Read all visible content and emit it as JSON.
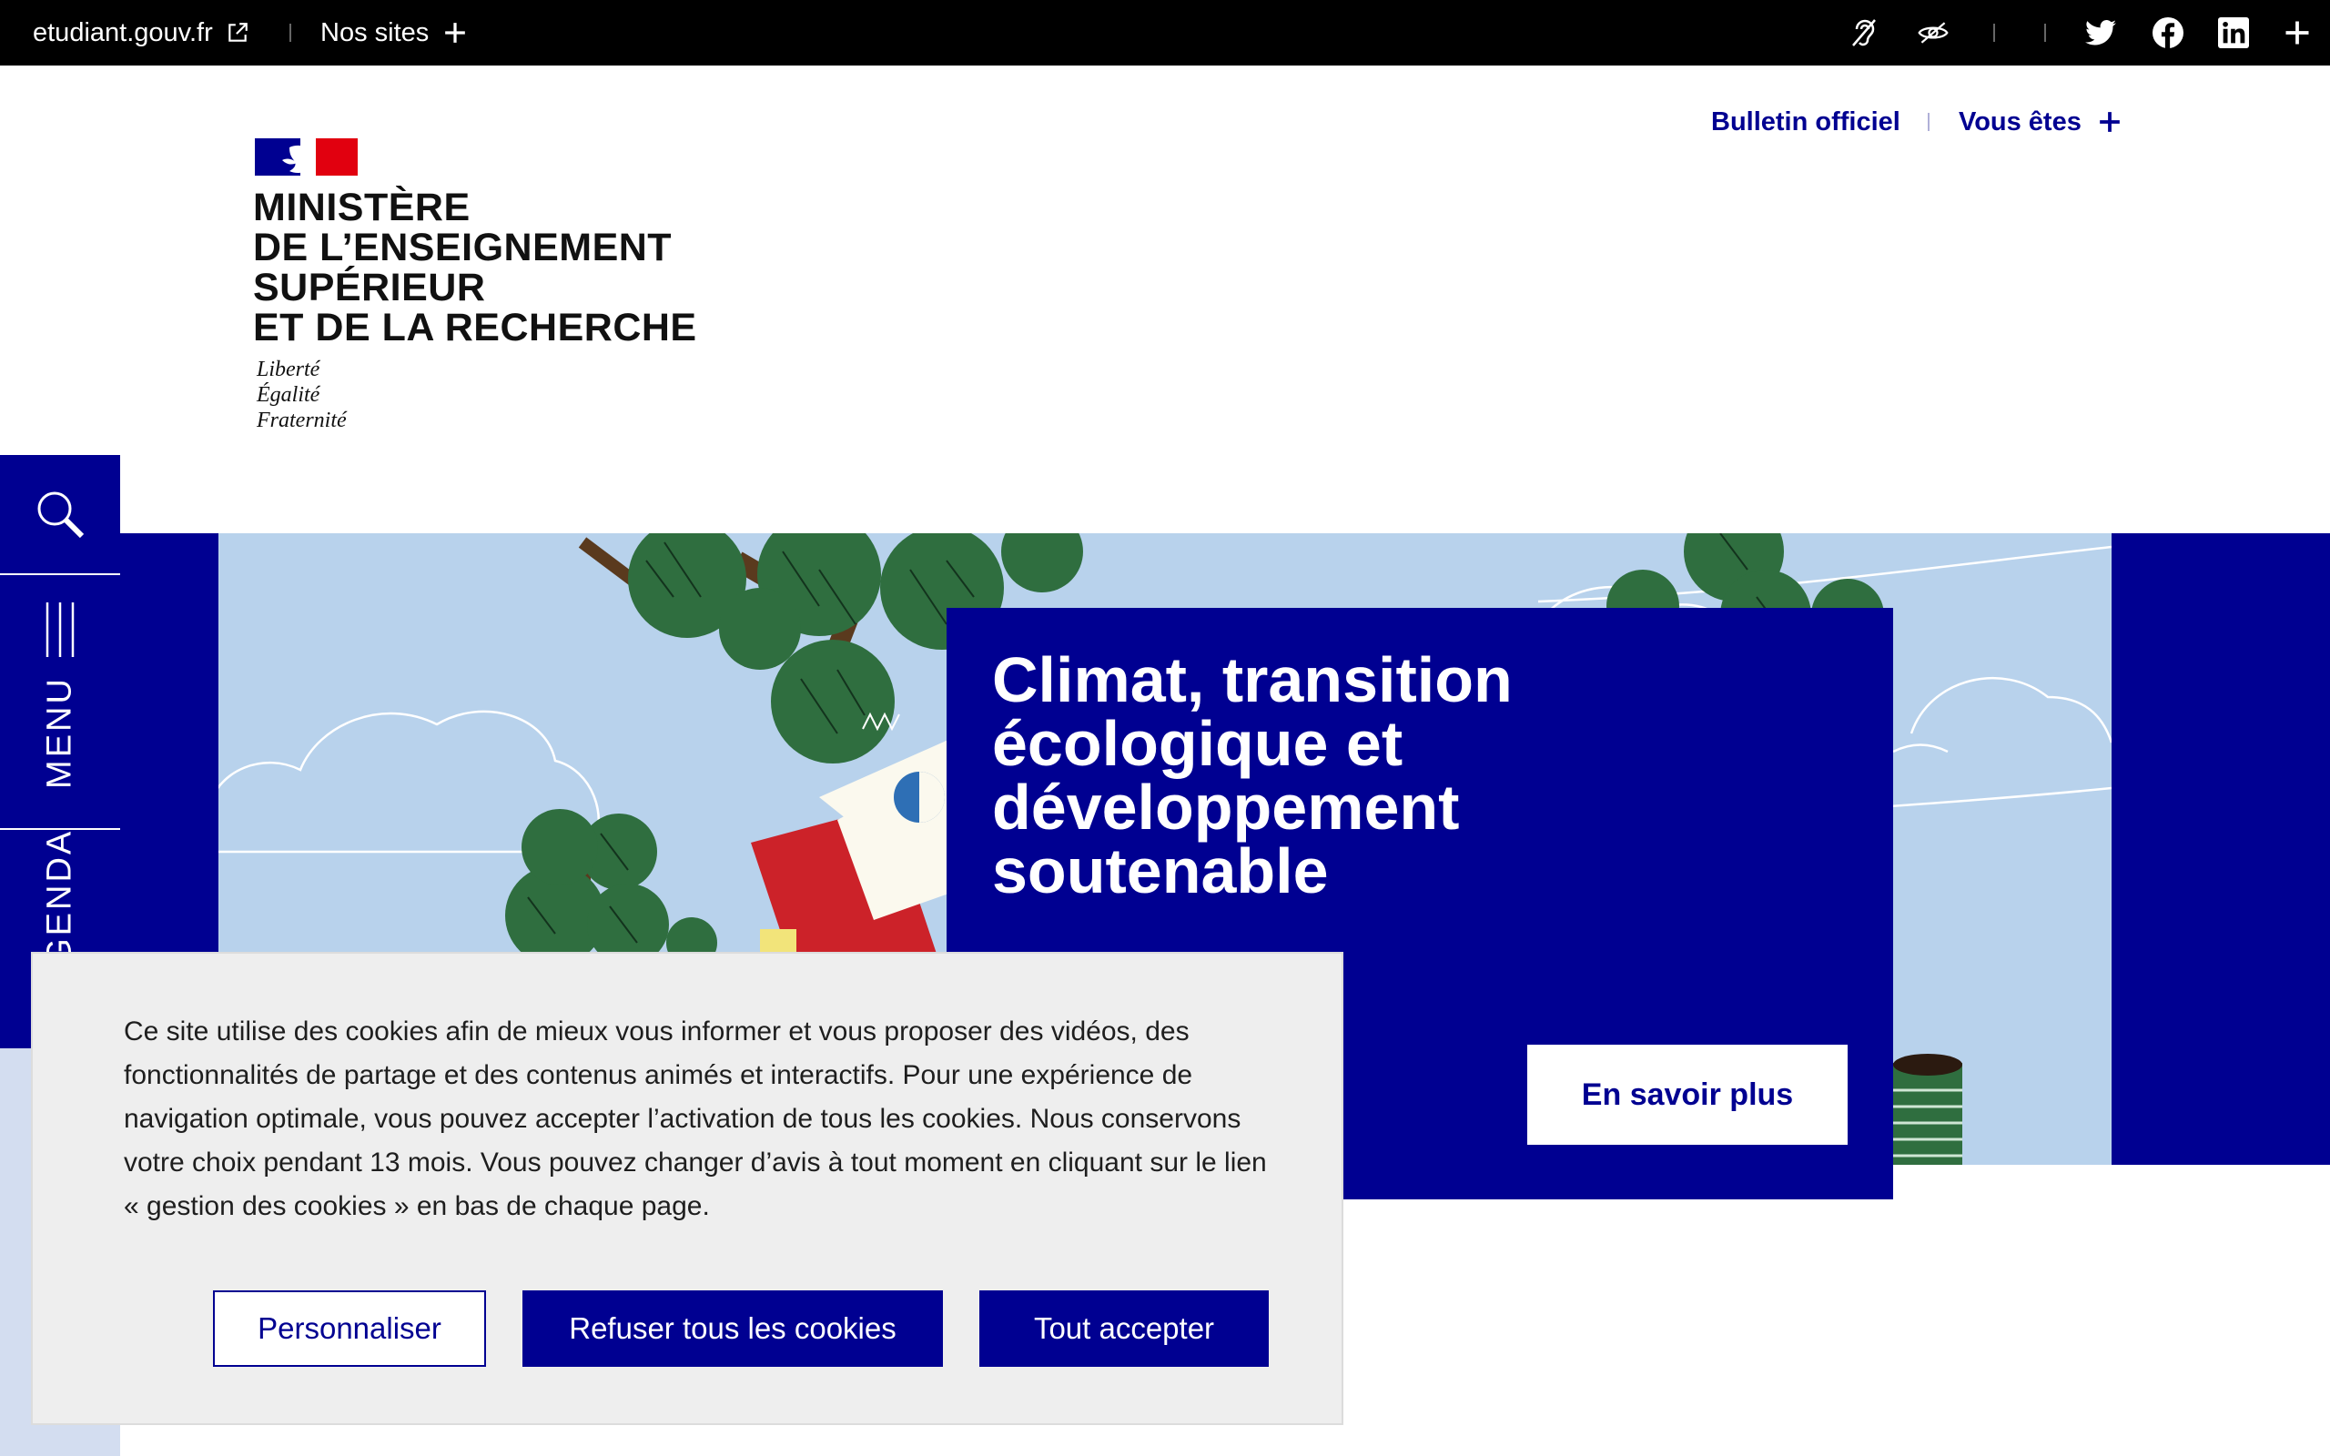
{
  "topbar": {
    "site_link": "etudiant.gouv.fr",
    "nos_sites": "Nos sites",
    "icons": [
      "external-link-icon",
      "plus-icon",
      "ear-icon",
      "eye-slash-icon",
      "twitter-icon",
      "facebook-icon",
      "linkedin-icon",
      "plus-icon"
    ]
  },
  "header": {
    "logo_lines": [
      "MINISTÈRE",
      "DE L’ENSEIGNEMENT",
      "SUPÉRIEUR",
      "ET DE LA RECHERCHE"
    ],
    "motto": [
      "Liberté",
      "Égalité",
      "Fraternité"
    ],
    "bulletin": "Bulletin officiel",
    "vous_etes": "Vous êtes"
  },
  "rail": {
    "menu": "MENU",
    "agenda": "AGENDA"
  },
  "hero": {
    "title": "Climat, transition écologique et développement soutenable",
    "button": "En savoir plus"
  },
  "cookie": {
    "text": "Ce site utilise des cookies afin de mieux vous informer et vous proposer des vidéos, des fonctionnalités de partage et des contenus animés et interactifs. Pour une expérience de navigation optimale, vous pouvez accepter l’activation de tous les cookies. Nous conservons votre choix pendant 13 mois. Vous pouvez changer d’avis à tout moment en cliquant sur le lien « gestion des cookies » en bas de chaque page.",
    "personnaliser": "Personnaliser",
    "refuser": "Refuser tous les cookies",
    "accepter": "Tout accepter"
  },
  "colors": {
    "primary": "#000091",
    "marianne_red": "#e1000f",
    "sky": "#b8d2ec",
    "tree_green": "#2f6e3f",
    "topbar": "#000000"
  }
}
